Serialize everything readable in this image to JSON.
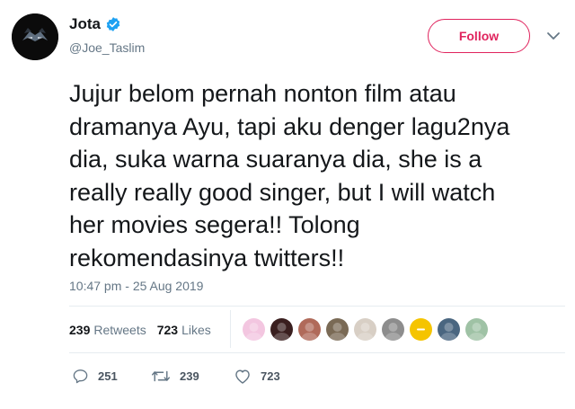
{
  "user": {
    "name": "Jota",
    "handle": "@Joe_Taslim",
    "verified_color": "#1da1f2"
  },
  "follow_button": {
    "label": "Follow",
    "color": "#e0245e"
  },
  "tweet": {
    "text": "Jujur belom pernah nonton film atau\ndramanya Ayu, tapi aku denger lagu2nya\ndia, suka warna suaranya dia, she is a\nreally really good singer, but I will watch\nher movies segera!! Tolong\nrekomendasinya twitters!!",
    "timestamp": "10:47 pm - 25 Aug 2019"
  },
  "stats": {
    "retweets_count": "239",
    "retweets_label": "Retweets",
    "likes_count": "723",
    "likes_label": "Likes"
  },
  "liker_avatars": [
    {
      "name": "liker-avatar-1",
      "color": "#f3c6e0"
    },
    {
      "name": "liker-avatar-2",
      "color": "#3a1f1f"
    },
    {
      "name": "liker-avatar-3",
      "color": "#b06a5a"
    },
    {
      "name": "liker-avatar-4",
      "color": "#7a6a55"
    },
    {
      "name": "liker-avatar-5",
      "color": "#d8cfc5"
    },
    {
      "name": "liker-avatar-6",
      "color": "#8d8d8d"
    },
    {
      "name": "liker-avatar-7",
      "color": "#f5c400"
    },
    {
      "name": "liker-avatar-8",
      "color": "#4a6680"
    },
    {
      "name": "liker-avatar-9",
      "color": "#9fc2a5"
    }
  ],
  "actions": {
    "replies": "251",
    "retweets": "239",
    "likes": "723"
  },
  "icons": {
    "avatar": "ninja-mask-avatar",
    "verified": "verified-badge-icon",
    "chevron": "chevron-down-icon",
    "reply": "reply-icon",
    "retweet": "retweet-icon",
    "like": "heart-icon"
  }
}
